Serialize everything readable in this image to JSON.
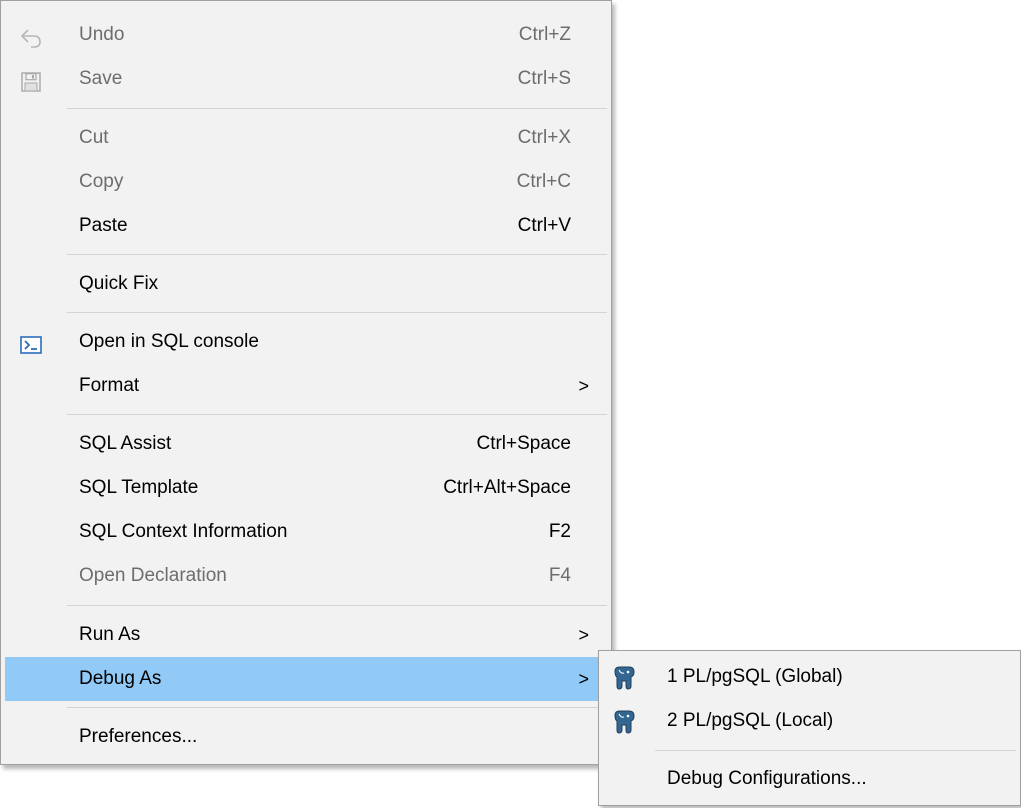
{
  "context_menu": {
    "items": [
      {
        "label": "Undo",
        "shortcut": "Ctrl+Z",
        "icon": "undo-icon"
      },
      {
        "label": "Save",
        "shortcut": "Ctrl+S",
        "icon": "save-icon"
      },
      {
        "label": "Cut",
        "shortcut": "Ctrl+X"
      },
      {
        "label": "Copy",
        "shortcut": "Ctrl+C"
      },
      {
        "label": "Paste",
        "shortcut": "Ctrl+V"
      },
      {
        "label": "Quick Fix"
      },
      {
        "label": "Open in SQL console",
        "icon": "sql-console-icon"
      },
      {
        "label": "Format",
        "submenu": true
      },
      {
        "label": "SQL Assist",
        "shortcut": "Ctrl+Space"
      },
      {
        "label": "SQL Template",
        "shortcut": "Ctrl+Alt+Space"
      },
      {
        "label": "SQL Context Information",
        "shortcut": "F2"
      },
      {
        "label": "Open Declaration",
        "shortcut": "F4"
      },
      {
        "label": "Run As",
        "submenu": true
      },
      {
        "label": "Debug As",
        "submenu": true,
        "selected": true
      },
      {
        "label": "Preferences..."
      }
    ],
    "submenu_arrow": ">"
  },
  "debug_as_submenu": {
    "items": [
      {
        "label": "1 PL/pgSQL (Global)",
        "icon": "postgresql-elephant-icon"
      },
      {
        "label": "2 PL/pgSQL (Local)",
        "icon": "postgresql-elephant-icon"
      },
      {
        "label": "Debug Configurations..."
      }
    ]
  },
  "colors": {
    "menu_background": "#f2f2f2",
    "selected_background": "#91c9f7",
    "disabled_text": "#6d6d6d",
    "separator": "#d4d4d4"
  }
}
